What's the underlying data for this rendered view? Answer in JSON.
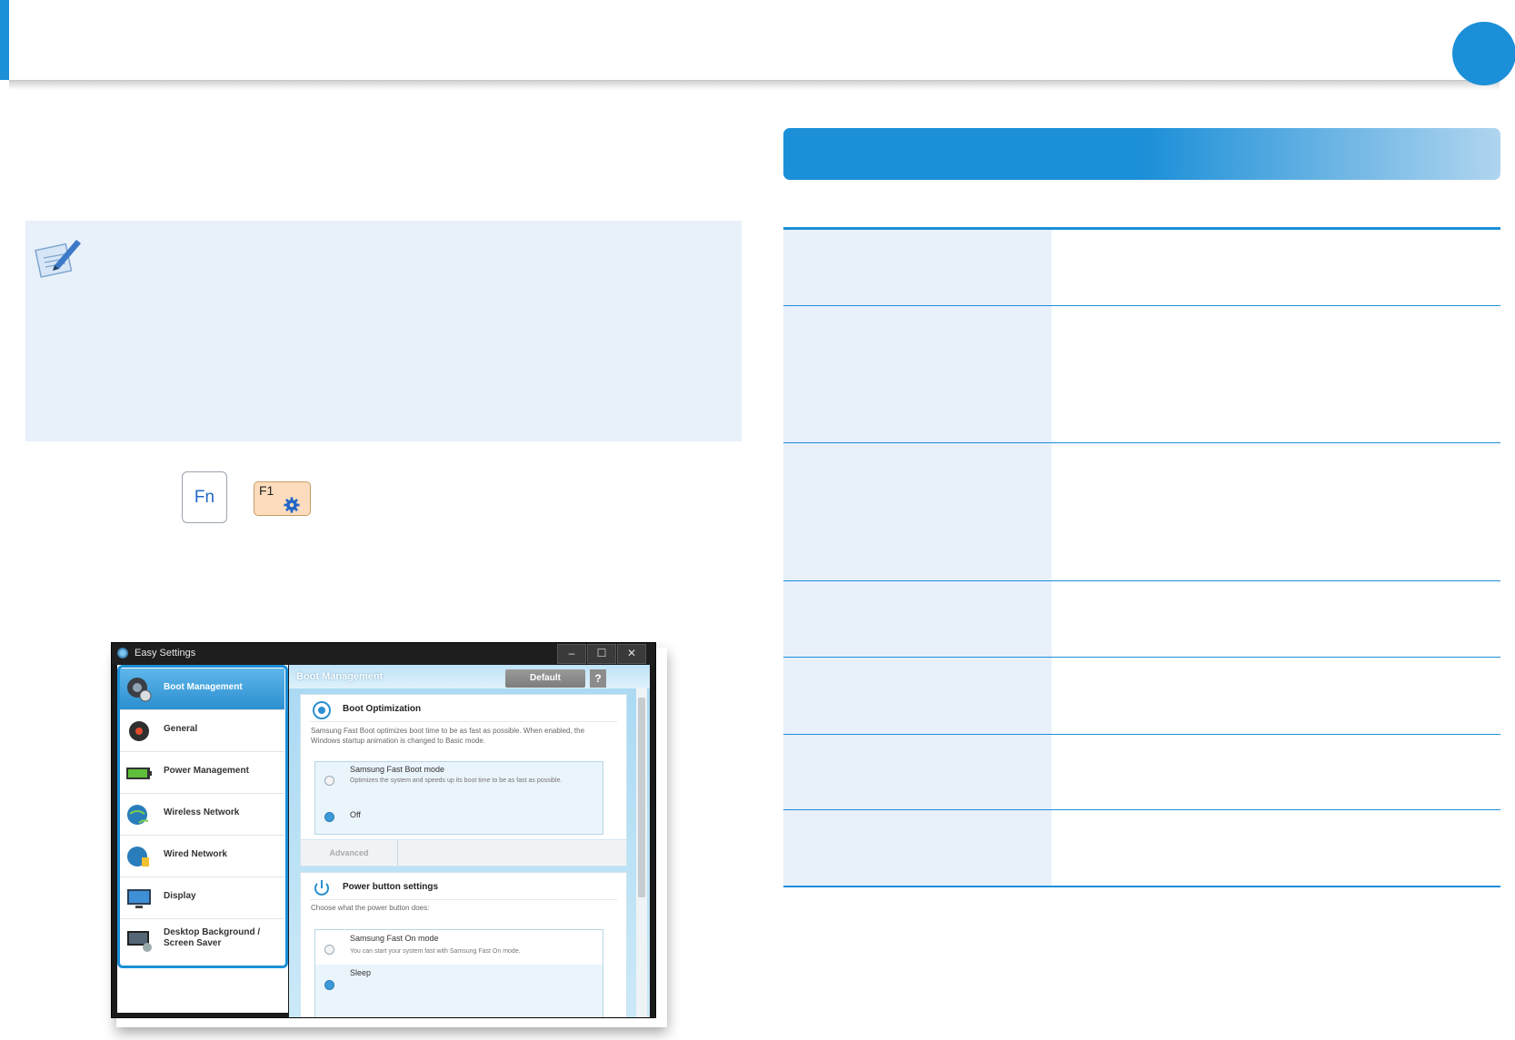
{
  "keys": {
    "fn": "Fn",
    "f1": "F1"
  },
  "app": {
    "title": "Easy Settings",
    "window_buttons": [
      "–",
      "☐",
      "✕"
    ],
    "sidebar": {
      "items": [
        {
          "label": "Boot Management",
          "icon": "boot-management-icon",
          "active": true
        },
        {
          "label": "General",
          "icon": "general-icon"
        },
        {
          "label": "Power Management",
          "icon": "battery-icon"
        },
        {
          "label": "Wireless Network",
          "icon": "wireless-network-icon"
        },
        {
          "label": "Wired Network",
          "icon": "wired-network-icon"
        },
        {
          "label": "Display",
          "icon": "display-icon"
        },
        {
          "label": "Desktop Background / Screen Saver",
          "line1": "Desktop Background /",
          "line2": "Screen Saver",
          "icon": "desktop-background-icon"
        }
      ]
    },
    "content": {
      "header": "Boot Management",
      "default_label": "Default",
      "help_label": "?",
      "boot_optimization": {
        "title": "Boot Optimization",
        "description": "Samsung Fast Boot optimizes boot time to be as fast as possible. When enabled, the Windows startup animation is changed to Basic mode.",
        "options": [
          {
            "title": "Samsung Fast Boot mode",
            "desc": "Optimizes the system and speeds up its boot time to be as fast as possible.",
            "selected": false
          },
          {
            "title": "Off",
            "selected": true
          }
        ],
        "advanced_label": "Advanced"
      },
      "power_button": {
        "title": "Power button settings",
        "description": "Choose what the power button does:",
        "options": [
          {
            "title": "Samsung Fast On mode",
            "desc": "You can start your system fast with Samsung Fast On mode.",
            "selected": false
          },
          {
            "title": "Sleep",
            "selected": true
          }
        ]
      }
    }
  },
  "colors": {
    "accent": "#1b8fd8",
    "note_bg": "#e8f0fa",
    "key_f1_bg": "#fcdcbc"
  }
}
